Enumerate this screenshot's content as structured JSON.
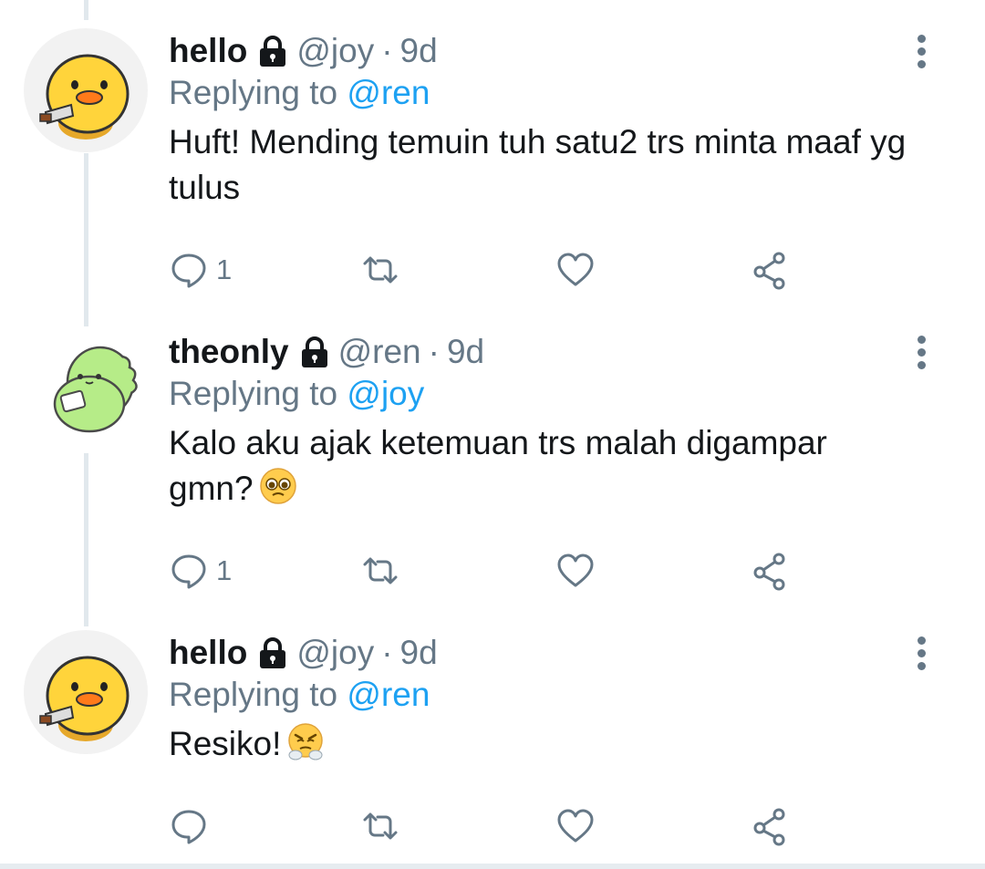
{
  "tweets": [
    {
      "name": "hello",
      "handle": "@joy",
      "separator": "·",
      "time": "9d",
      "replying_prefix": "Replying to",
      "replying_to": "@ren",
      "text": "Huft! Mending temuin tuh satu2 trs minta maaf yg tulus",
      "emoji": "",
      "reply_count": "1",
      "avatar": "duck-avatar"
    },
    {
      "name": "theonly",
      "handle": "@ren",
      "separator": "·",
      "time": "9d",
      "replying_prefix": "Replying to",
      "replying_to": "@joy",
      "text": "Kalo aku ajak ketemuan trs malah digampar gmn?",
      "emoji": "pleading-face",
      "reply_count": "1",
      "avatar": "dino-avatar"
    },
    {
      "name": "hello",
      "handle": "@joy",
      "separator": "·",
      "time": "9d",
      "replying_prefix": "Replying to",
      "replying_to": "@ren",
      "text": "Resiko!",
      "emoji": "face-with-steam",
      "reply_count": "",
      "avatar": "duck-avatar"
    }
  ],
  "icons": {
    "reply": "comment-icon",
    "retweet": "retweet-icon",
    "like": "heart-icon",
    "share": "share-icon",
    "more": "more-vertical-icon",
    "lock": "lock-icon"
  },
  "colors": {
    "link": "#1da1f2",
    "secondary_text": "#657786",
    "primary_text": "#14171a",
    "thread_line": "#e1e8ed"
  }
}
